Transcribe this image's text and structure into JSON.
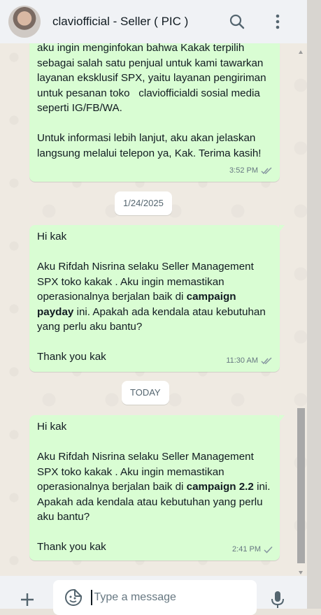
{
  "header": {
    "title": "claviofficial - Seller ( PIC )"
  },
  "messages": [
    {
      "text_lines": [
        "aku ingin menginfokan bahwa Kakak terpilih",
        "sebagai salah satu penjual untuk kami tawarkan",
        "layanan eksklusif SPX, yaitu layanan pengiriman",
        "untuk pesanan toko   claviofficialdi sosial media",
        "seperti IG/FB/WA.",
        "",
        "Untuk informasi lebih lanjut, aku akan jelaskan",
        "langsung melalui telepon ya, Kak. Terima kasih!"
      ],
      "time": "3:52 PM",
      "status": "read"
    },
    {
      "greeting": "Hi kak",
      "body_before": "Aku Rifdah Nisrina selaku Seller Management SPX toko kakak . Aku ingin memastikan operasionalnya berjalan baik di ",
      "bold": "campaign payday",
      "body_after": " ini. Apakah ada kendala atau kebutuhan yang perlu aku bantu?",
      "closing": "Thank you kak",
      "time": "11:30 AM",
      "status": "read"
    },
    {
      "greeting": "Hi kak",
      "body_before": "Aku Rifdah Nisrina selaku Seller Management SPX toko kakak . Aku ingin memastikan operasionalnya berjalan baik di ",
      "bold": "campaign 2.2",
      "body_after": " ini. Apakah ada kendala atau kebutuhan yang perlu aku bantu?",
      "closing": "Thank you kak",
      "time": "2:41 PM",
      "status": "sent"
    }
  ],
  "dates": {
    "first": "1/24/2025",
    "second": "TODAY"
  },
  "composer": {
    "placeholder": "Type a message"
  },
  "icons": {
    "search": "search-icon",
    "menu": "kebab-menu-icon",
    "attach": "plus-icon",
    "emoji": "emoji-sticker-icon",
    "mic": "microphone-icon"
  },
  "colors": {
    "outgoing_bubble": "#d9fdd3",
    "header_bg": "#f0f2f5",
    "read_ticks": "#8696a0"
  }
}
